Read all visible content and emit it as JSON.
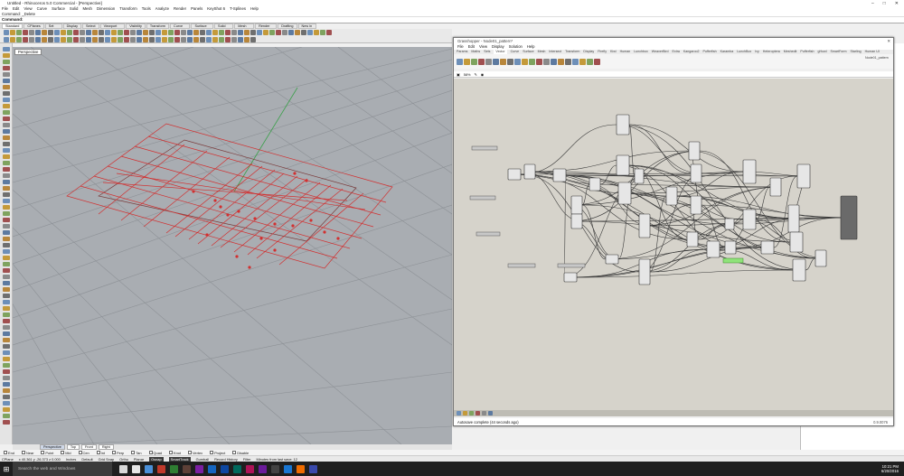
{
  "titlebar": {
    "title": "Untitled - Rhinoceros 5.0 Commercial - [Perspective]"
  },
  "rhino_menu": [
    "File",
    "Edit",
    "View",
    "Curve",
    "Surface",
    "Solid",
    "Mesh",
    "Dimension",
    "Transform",
    "Tools",
    "Analyze",
    "Render",
    "Panels",
    "KeyShot 6",
    "T-Splines",
    "Help"
  ],
  "command_history": "Command: _Delete",
  "command_prompt": "Command:",
  "toolbar_tabs": [
    "Standard",
    "CPlanes",
    "Set View",
    "Display",
    "Select",
    "Viewport Layout",
    "Visibility",
    "Transform",
    "Curve Tools",
    "Surface Tools",
    "Solid Tools",
    "Mesh Tools",
    "Render Tools",
    "Drafting",
    "New in V5"
  ],
  "viewport": {
    "label": "Perspective",
    "tabs": [
      "Perspective",
      "Top",
      "Front",
      "Right"
    ],
    "grid_color": "#a9adb2",
    "geometry_color": "#d23030"
  },
  "osnaps": [
    "End",
    "Near",
    "Point",
    "Mid",
    "Cen",
    "Int",
    "Perp",
    "Tan",
    "Quad",
    "Knot",
    "Vertex",
    "Project",
    "Disable"
  ],
  "statusbar": {
    "cplane": "CPlane",
    "coords": "x 40.361  y -26.373  z 0.000",
    "units": "Inches",
    "layer": "Default",
    "items": [
      "Grid Snap",
      "Ortho",
      "Planar",
      "Osnap",
      "SmartTrack",
      "Gumball",
      "Record History",
      "Filter",
      "Minutes from last save: 12"
    ],
    "highlight": [
      "Osnap",
      "SmartTrack"
    ]
  },
  "taskbar": {
    "search_placeholder": "Search the web and Windows",
    "time": "10:21 PM",
    "date": "6/20/2016",
    "app_colors": [
      "#d9d9d9",
      "#e6e6e6",
      "#4a90d9",
      "#c0392b",
      "#2e7d32",
      "#5d4037",
      "#7b1fa2",
      "#1565c0",
      "#0d47a1",
      "#00695c",
      "#ad1457",
      "#6a1b9a",
      "#424242",
      "#1976d2",
      "#ef6c00",
      "#3949ab"
    ]
  },
  "grasshopper": {
    "title": "Grasshopper - Node01_pattern*",
    "menu": [
      "File",
      "Edit",
      "View",
      "Display",
      "Solution",
      "Help"
    ],
    "tabs": [
      "Params",
      "Maths",
      "Sets",
      "Vector",
      "Curve",
      "Surface",
      "Mesh",
      "Intersect",
      "Transform",
      "Display",
      "Firefly",
      "Kiwi",
      "Human",
      "Lunchbox",
      "WeaverBird",
      "Extra",
      "Kangaroo2",
      "Pufferfish",
      "Karamba",
      "LunchBox",
      "Ivy",
      "Heteroptera",
      "Meshedit",
      "Pufferfish",
      "gHowl",
      "SmartForm",
      "Starling",
      "Human UI"
    ],
    "active_tab": "Vector",
    "doc_name": "Node01_pattern",
    "zoom": "58%",
    "status": "Autosave complete (44 seconds ago)",
    "version": "0.9.0076",
    "canvas_bg": "#d6d3cb"
  }
}
